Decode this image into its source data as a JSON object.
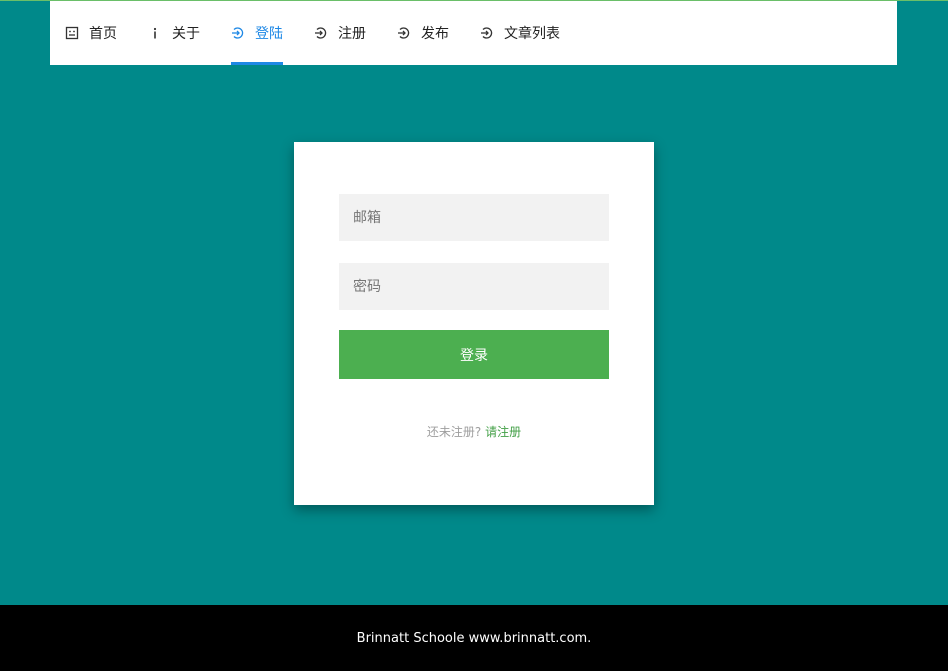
{
  "nav": {
    "items": [
      {
        "label": "首页",
        "icon": "home-icon"
      },
      {
        "label": "关于",
        "icon": "info-icon"
      },
      {
        "label": "登陆",
        "icon": "login-icon",
        "active": true
      },
      {
        "label": "注册",
        "icon": "login-icon"
      },
      {
        "label": "发布",
        "icon": "login-icon"
      },
      {
        "label": "文章列表",
        "icon": "login-icon"
      }
    ]
  },
  "login": {
    "email_placeholder": "邮箱",
    "password_placeholder": "密码",
    "submit_label": "登录",
    "register_prompt": "还未注册?",
    "register_link": "请注册"
  },
  "footer": {
    "text": "Brinnatt Schoole www.brinnatt.com."
  },
  "colors": {
    "background": "#00898a",
    "accent": "#1e88e5",
    "button": "#4caf50",
    "link": "#43a047"
  }
}
